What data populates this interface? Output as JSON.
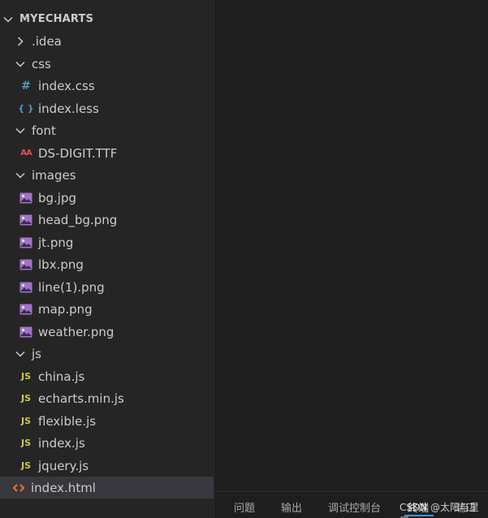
{
  "explorer": {
    "root_label": "MYECHARTS",
    "items": [
      {
        "label": ".idea",
        "type": "folder",
        "expanded": false,
        "icon": "chevron-right-icon"
      },
      {
        "label": "css",
        "type": "folder",
        "expanded": true,
        "icon": "chevron-down-icon"
      },
      {
        "label": "index.css",
        "type": "file",
        "icon": "css-file-icon"
      },
      {
        "label": "index.less",
        "type": "file",
        "icon": "less-file-icon"
      },
      {
        "label": "font",
        "type": "folder",
        "expanded": true,
        "icon": "chevron-down-icon"
      },
      {
        "label": "DS-DIGIT.TTF",
        "type": "file",
        "icon": "font-file-icon"
      },
      {
        "label": "images",
        "type": "folder",
        "expanded": true,
        "icon": "chevron-down-icon"
      },
      {
        "label": "bg.jpg",
        "type": "file",
        "icon": "image-file-icon"
      },
      {
        "label": "head_bg.png",
        "type": "file",
        "icon": "image-file-icon"
      },
      {
        "label": "jt.png",
        "type": "file",
        "icon": "image-file-icon"
      },
      {
        "label": "lbx.png",
        "type": "file",
        "icon": "image-file-icon"
      },
      {
        "label": "line(1).png",
        "type": "file",
        "icon": "image-file-icon"
      },
      {
        "label": "map.png",
        "type": "file",
        "icon": "image-file-icon"
      },
      {
        "label": "weather.png",
        "type": "file",
        "icon": "image-file-icon"
      },
      {
        "label": "js",
        "type": "folder",
        "expanded": true,
        "icon": "chevron-down-icon"
      },
      {
        "label": "china.js",
        "type": "file",
        "icon": "js-file-icon"
      },
      {
        "label": "echarts.min.js",
        "type": "file",
        "icon": "js-file-icon"
      },
      {
        "label": "flexible.js",
        "type": "file",
        "icon": "js-file-icon"
      },
      {
        "label": "index.js",
        "type": "file",
        "icon": "js-file-icon"
      },
      {
        "label": "jquery.js",
        "type": "file",
        "icon": "js-file-icon"
      },
      {
        "label": "index.html",
        "type": "file",
        "icon": "html-file-icon",
        "selected": true
      }
    ]
  },
  "icon_glyphs": {
    "css": "#",
    "less": "{ }",
    "font": "AΑ",
    "js": "JS"
  },
  "panel": {
    "tabs": [
      "问题",
      "输出",
      "调试控制台",
      "终端",
      "端口"
    ],
    "active_tab": "终端"
  },
  "watermark": "CSDN @太阳与星辰",
  "colors": {
    "sidebar_bg": "#252526",
    "editor_bg": "#1e1e1e",
    "selected_row": "#37373d",
    "css_icon": "#519aba",
    "less_icon": "#519aba",
    "font_icon": "#e05252",
    "image_icon": "#a074c4",
    "js_icon": "#cbcb41",
    "html_icon": "#e37933"
  }
}
